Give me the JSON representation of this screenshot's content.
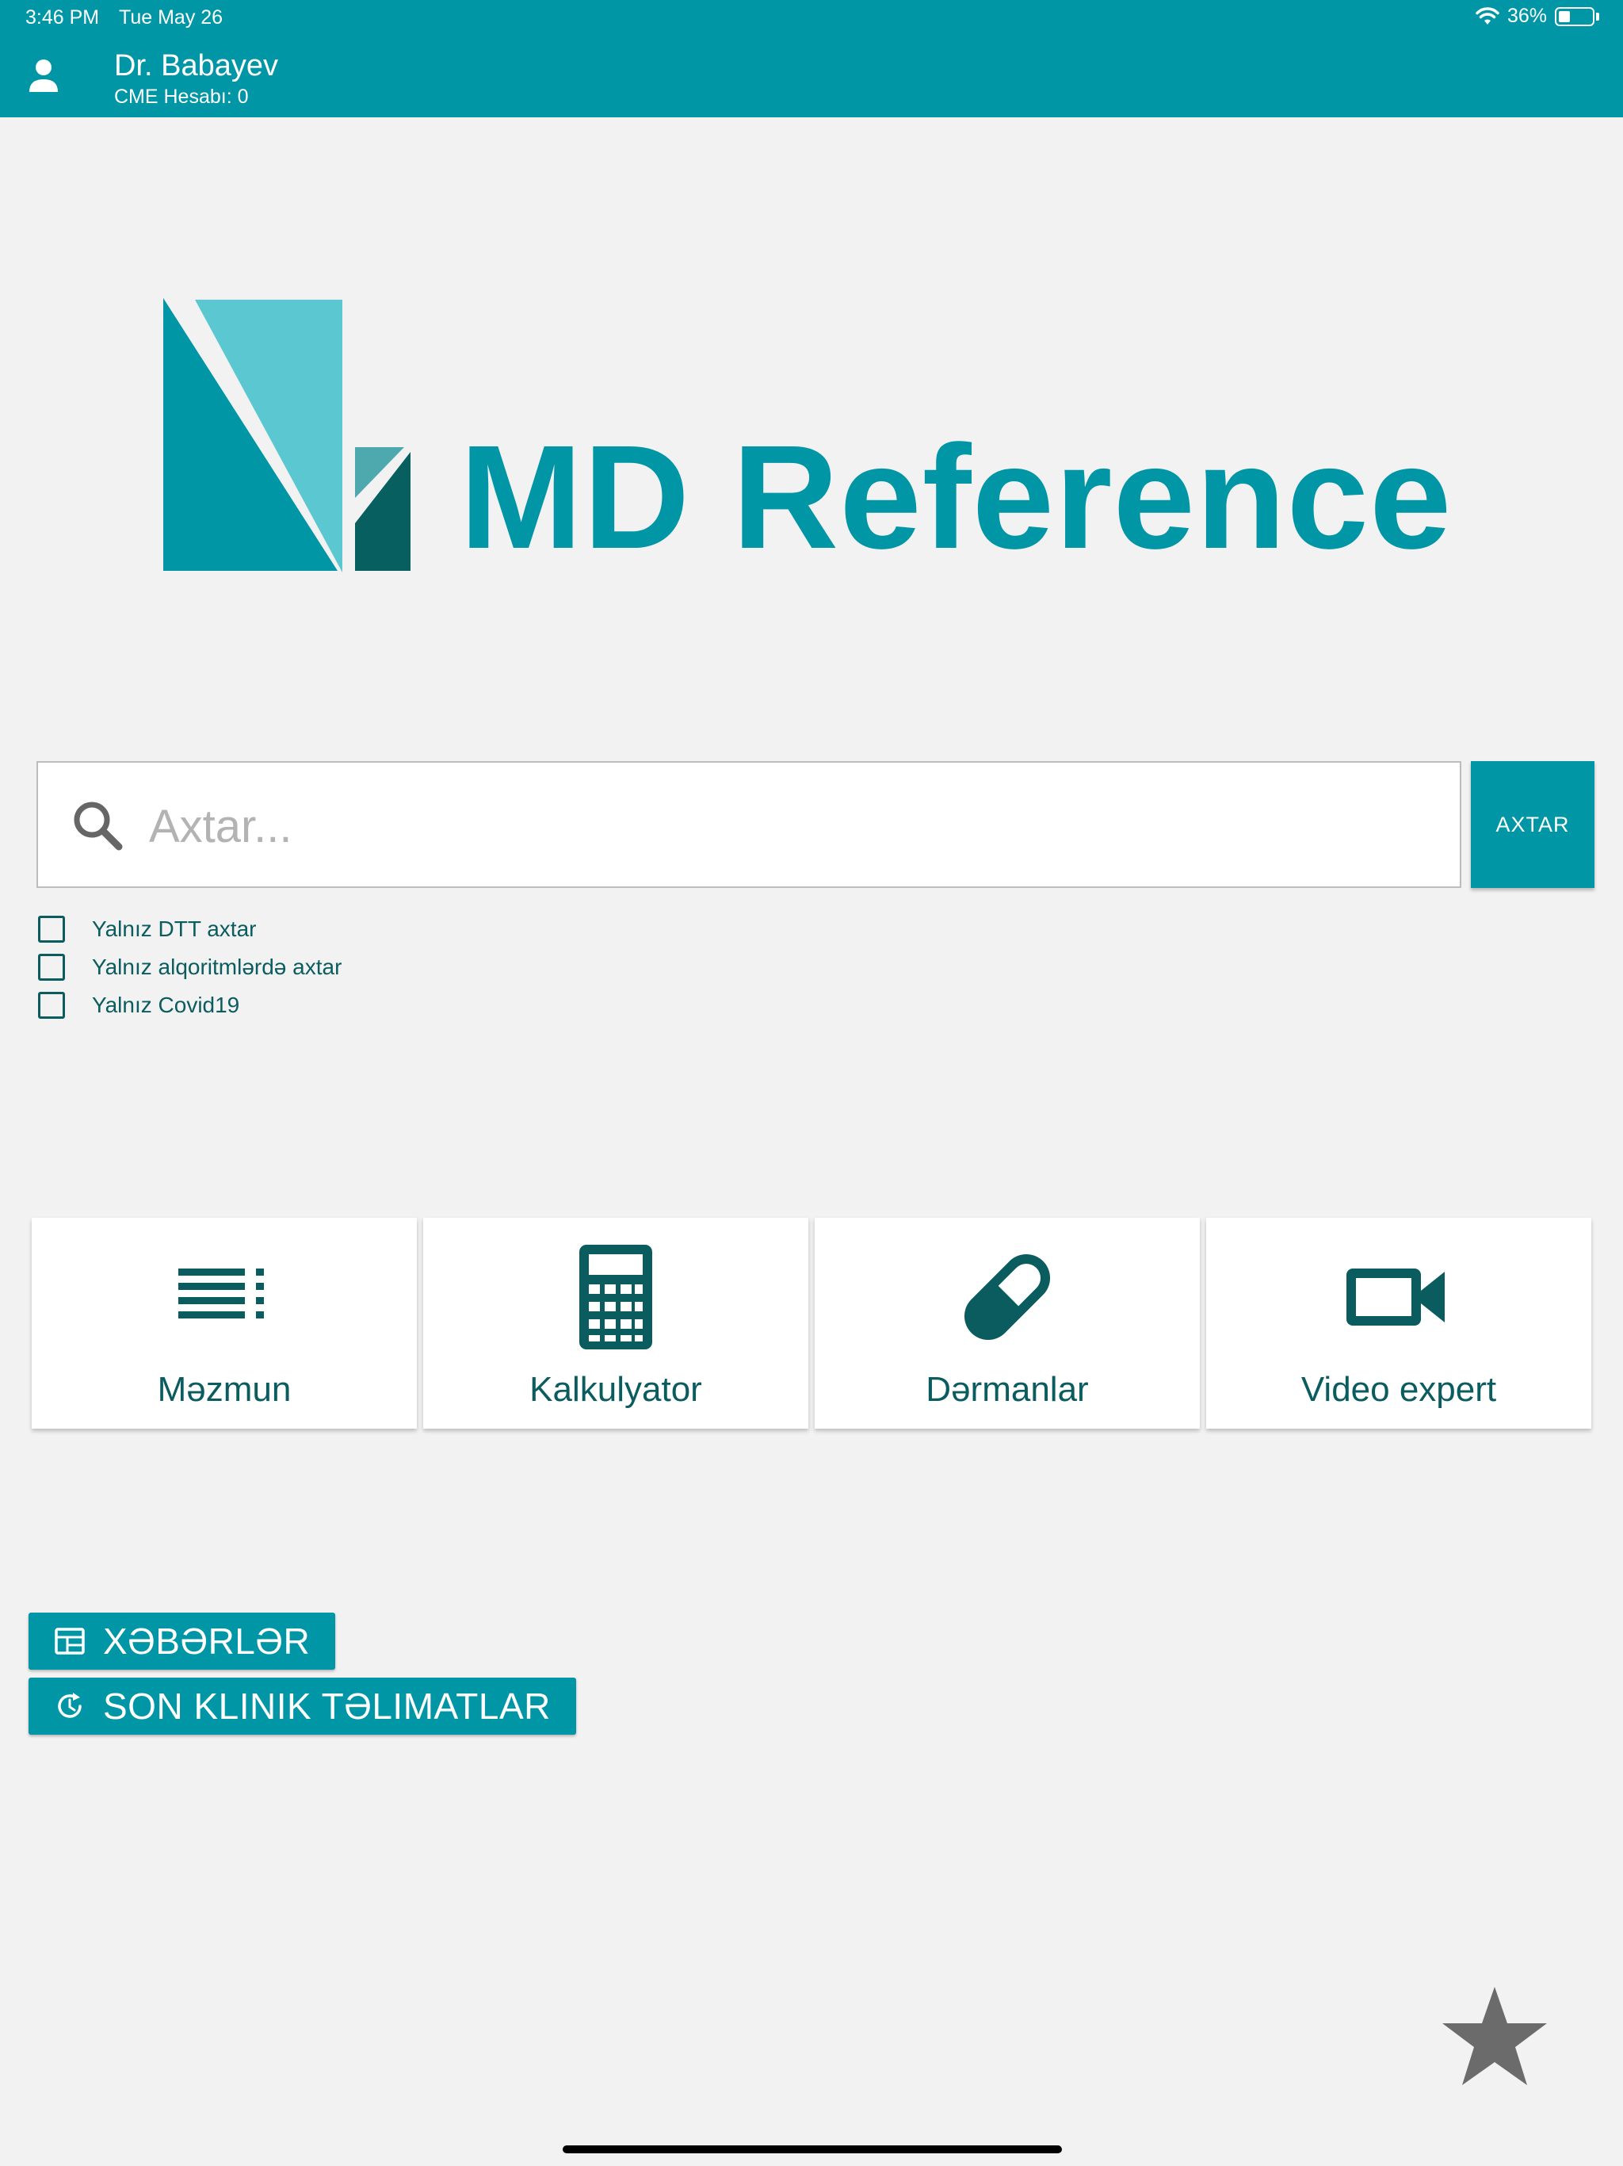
{
  "status_bar": {
    "time": "3:46 PM",
    "date": "Tue May 26",
    "battery": "36%",
    "battery_level": 0.36
  },
  "header": {
    "user_name": "Dr. Babayev",
    "cme_label": "CME Hesabı: 0"
  },
  "logo": {
    "text": "MD Reference"
  },
  "search": {
    "placeholder": "Axtar...",
    "value": "",
    "button_label": "AXTAR"
  },
  "filters": [
    {
      "label": "Yalnız DTT axtar",
      "checked": false
    },
    {
      "label": "Yalnız alqoritmlərdə axtar",
      "checked": false
    },
    {
      "label": "Yalnız Covid19",
      "checked": false
    }
  ],
  "tiles": [
    {
      "label": "Məzmun",
      "icon": "list-icon"
    },
    {
      "label": "Kalkulyator",
      "icon": "calculator-icon"
    },
    {
      "label": "Dərmanlar",
      "icon": "pill-icon"
    },
    {
      "label": "Video expert",
      "icon": "video-camera-icon"
    }
  ],
  "links": {
    "news_label": "XƏBƏRLƏR",
    "guidelines_label": "SON KLINIK TƏLIMATLAR"
  },
  "colors": {
    "primary": "#0096a6",
    "dark_teal": "#0a5c5f",
    "light_teal": "#5bc8d1",
    "background": "#f2f2f2"
  }
}
